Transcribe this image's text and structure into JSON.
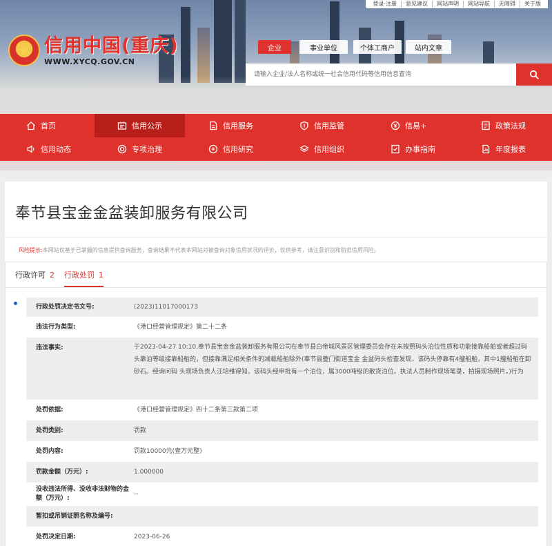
{
  "top_links": [
    "登录·注册",
    "意见建议",
    "网站声明",
    "网站导航",
    "无障碍",
    "关于版"
  ],
  "logo": {
    "title": "信用中国(重庆)",
    "url": "WWW.XYCQ.GOV.CN",
    "emblem": "national-emblem-icon"
  },
  "search": {
    "tabs": [
      "企业",
      "事业单位",
      "个体工商户",
      "站内文章"
    ],
    "active_tab": "企业",
    "placeholder": "请输入企业/法人名称或统一社会信用代码等信用信息查询",
    "button_icon": "search-icon"
  },
  "nav": {
    "row1": [
      {
        "label": "首页",
        "icon": "home-icon"
      },
      {
        "label": "信用公示",
        "icon": "notice-icon",
        "active": true
      },
      {
        "label": "信用服务",
        "icon": "document-icon"
      },
      {
        "label": "信用监管",
        "icon": "shield-icon"
      },
      {
        "label": "信易+",
        "icon": "coin-icon"
      },
      {
        "label": "政策法规",
        "icon": "book-icon"
      }
    ],
    "row2": [
      {
        "label": "信用动态",
        "icon": "speaker-icon"
      },
      {
        "label": "专项治理",
        "icon": "target-icon"
      },
      {
        "label": "信用研究",
        "icon": "research-icon"
      },
      {
        "label": "信用组织",
        "icon": "layers-icon"
      },
      {
        "label": "办事指南",
        "icon": "guide-icon"
      },
      {
        "label": "年度报表",
        "icon": "report-icon"
      }
    ]
  },
  "company_name": "奉节县宝金金盆装卸服务有限公司",
  "risk": {
    "label": "风险提示:",
    "text": "本网站仅基于已掌握的信息提供查询服务，查询结果不代表本网站对被查询对象信用状况的评价，仅供参考，请注意识别和防范信用风险。"
  },
  "tabs": [
    {
      "label": "行政许可",
      "count": "2"
    },
    {
      "label": "行政处罚",
      "count": "1",
      "active": true
    }
  ],
  "record": [
    {
      "key": "行政处罚决定书文号:",
      "value": "(2023)11017000173"
    },
    {
      "key": "违法行为类型:",
      "value": "《港口经营管理规定》第二十二条"
    },
    {
      "key": "违法事实:",
      "value": "于2023-04-27 10:10,奉节县宝金金盆装卸服务有限公司在奉节县白帝城风景区管理委员会存在未按照码头泊位性质和功能接靠船舶或者超过码头靠泊等级接靠船舶的，但接靠满足相关条件的减载船舶除外(奉节县夔门街道宝金 金盆码头检查发现，该码头停靠有4艘船舶，其中1艘船舶在卸砂石。经询问码 头现场负责人汪培维得知，该码头经申批有一个泊位，属3000吨级的散货泊位。执法人员制作现场笔录，拍摄现场照片。)行为"
    },
    {
      "key": "处罚依据:",
      "value": "《港口经营管理规定》四十二条第三款第二项"
    },
    {
      "key": "处罚类别:",
      "value": "罚款"
    },
    {
      "key": "处罚内容:",
      "value": "罚款10000元(壹万元整)"
    },
    {
      "key": "罚款金额（万元）:",
      "value": "1.000000"
    },
    {
      "key": "没收违法所得、没收非法财物的金额（万元）:",
      "value": "--"
    },
    {
      "key": "暂扣或吊销证照名称及编号:",
      "value": ""
    },
    {
      "key": "处罚决定日期:",
      "value": "2023-06-26"
    }
  ],
  "colors": {
    "brand_red": "#e0322c",
    "nav_active": "#b81f1a",
    "bullet_blue": "#1e5fbf"
  }
}
